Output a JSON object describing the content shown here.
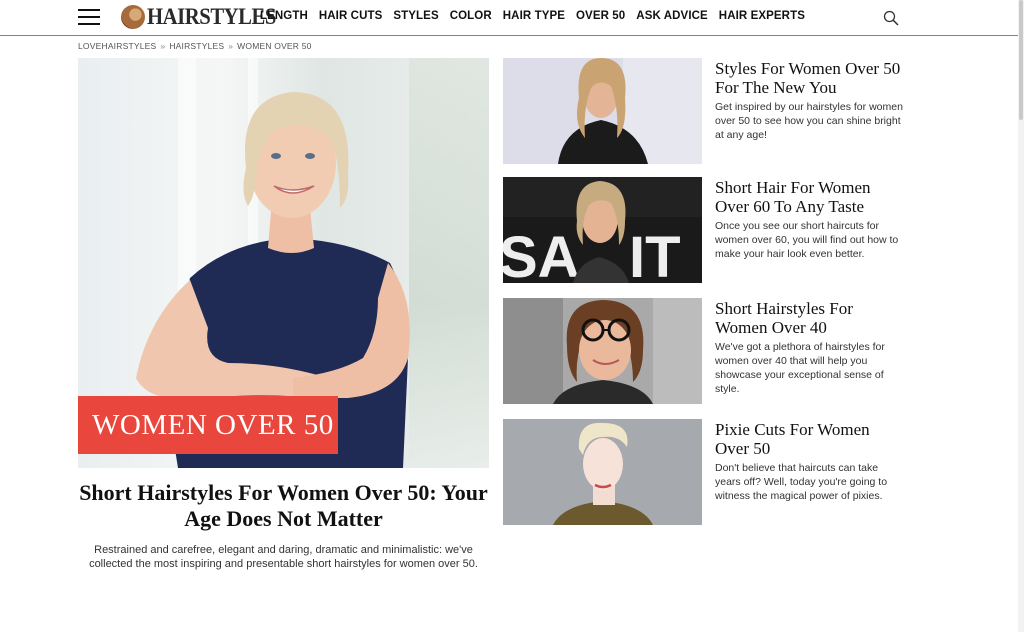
{
  "header": {
    "logo_text": "HAIRSTYLES",
    "nav": [
      "LENGTH",
      "HAIR CUTS",
      "STYLES",
      "COLOR",
      "HAIR TYPE",
      "OVER 50",
      "ASK ADVICE",
      "HAIR EXPERTS"
    ]
  },
  "breadcrumb": [
    "LOVEHAIRSTYLES",
    "HAIRSTYLES",
    "WOMEN OVER 50"
  ],
  "breadcrumb_sep": "»",
  "hero": {
    "badge": "WOMEN OVER 50",
    "title": "Short Hairstyles For Women Over 50: Your Age Does Not Matter",
    "description": "Restrained and carefree, elegant and daring, dramatic and minimalistic: we've collected the most inspiring and presentable short hairstyles for women over 50."
  },
  "cards": [
    {
      "title": "Styles For Women Over 50 For The New You",
      "description": "Get inspired by our hairstyles for women over 50 to see how you can shine bright at any age!"
    },
    {
      "title": "Short Hair For Women Over 60 To Any Taste",
      "description": "Once you see our short haircuts for women over 60, you will find out how to make your hair look even better."
    },
    {
      "title": "Short Hairstyles For Women Over 40",
      "description": "We've got a plethora of hairstyles for women over 40 that will help you showcase your exceptional sense of style."
    },
    {
      "title": "Pixie Cuts For Women Over 50",
      "description": "Don't believe that haircuts can take years off? Well, today you're going to witness the magical power of pixies."
    }
  ],
  "colors": {
    "accent": "#e9473d",
    "header_rule": "#e05a5a"
  },
  "icons": [
    "hamburger-menu-icon",
    "hair-logo-icon",
    "search-icon"
  ]
}
